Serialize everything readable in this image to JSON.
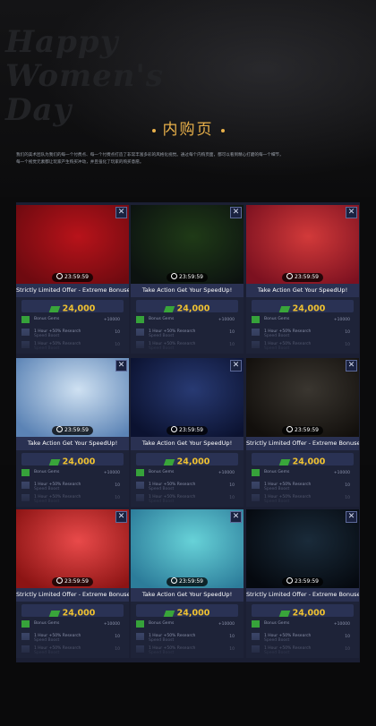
{
  "header": {
    "ghost_text": "Happy Women's Day",
    "title": "内购页",
    "description": "我们的美术团队为我们的每一个付费点、每一个付费点打造了非常丰富多彩的风格化视觉。通过每个内购页面，都可以看到精心打磨的每一个细节，每一个视觉元素都让玩家产生购买冲动，并且强化了玩家的购买意愿。"
  },
  "common": {
    "timer": "23:59:59",
    "price": "24,000",
    "row1_label": "Bonus Gems",
    "row1_qty": "+10000",
    "row2_label": "1 Hour +50% Research",
    "row2_sub": "Speed Boost",
    "row2_qty": "10",
    "row3_label": "1 Hour +50% Research",
    "row3_sub": "Speed Boost",
    "row3_qty": "10"
  },
  "cards": [
    {
      "caption": "Strictly Limited Offer - Extreme Bonuses!",
      "theme": "Chinese New Year",
      "bg": [
        "#b8131a",
        "#6e0a10"
      ]
    },
    {
      "caption": "Take Action Get Your SpeedUp!",
      "theme": "cauldron",
      "bg": [
        "#1f3a17",
        "#0c1210"
      ]
    },
    {
      "caption": "Take Action Get Your SpeedUp!",
      "theme": "Happy Women's Day",
      "bg": [
        "#d23a3a",
        "#7c1120"
      ]
    },
    {
      "caption": "Take Action Get Your SpeedUp!",
      "theme": "archer",
      "bg": [
        "#cfe1f2",
        "#5b83b5"
      ]
    },
    {
      "caption": "Take Action Get Your SpeedUp!",
      "theme": "demon",
      "bg": [
        "#283a73",
        "#0b1230"
      ]
    },
    {
      "caption": "Strictly Limited Offer - Extreme Bonuses!",
      "theme": "mafia",
      "bg": [
        "#3a3630",
        "#120f0c"
      ]
    },
    {
      "caption": "Strictly Limited Offer - Extreme Bonuses!",
      "theme": "2019",
      "bg": [
        "#e94a4a",
        "#8c1414"
      ]
    },
    {
      "caption": "Take Action Get Your SpeedUp!",
      "theme": "floating island",
      "bg": [
        "#67d2d8",
        "#2c7c9a"
      ]
    },
    {
      "caption": "Strictly Limited Offer - Extreme Bonuses!",
      "theme": "blue skulls",
      "bg": [
        "#1a2b3a",
        "#05090f"
      ]
    }
  ]
}
